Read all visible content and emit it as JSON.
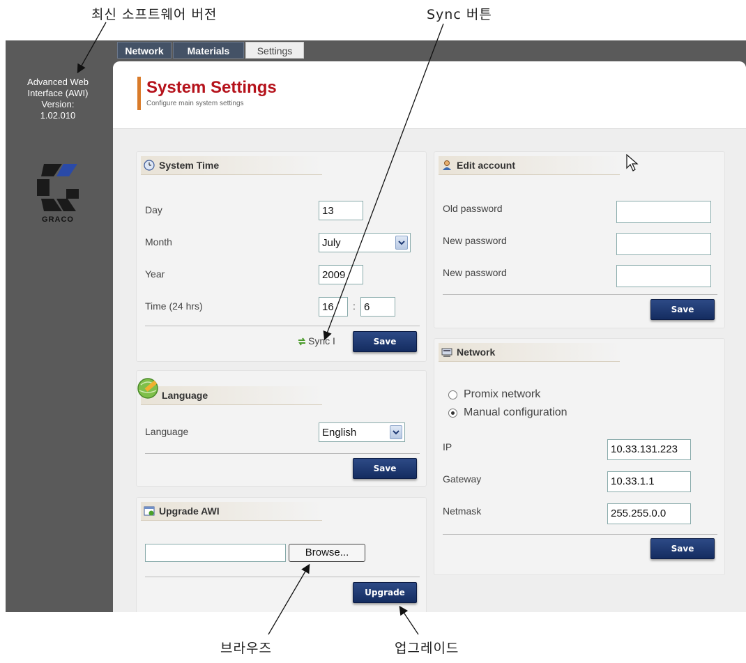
{
  "callouts": {
    "latest_version": "최신 소프트웨어 버전",
    "sync_button": "Sync 버튼",
    "browse": "브라우즈",
    "upgrade": "업그레이드"
  },
  "sidebar": {
    "version_line1": "Advanced Web",
    "version_line2": "Interface (AWI)",
    "version_line3": "Version:",
    "version_line4": "1.02.010",
    "logo_text": "GRACO"
  },
  "tabs": [
    {
      "label": "Network"
    },
    {
      "label": "Materials"
    },
    {
      "label": "Settings",
      "active": true
    }
  ],
  "header": {
    "title": "System Settings",
    "subtitle": "Configure main system settings"
  },
  "system_time": {
    "title": "System Time",
    "day_label": "Day",
    "day_value": "13",
    "month_label": "Month",
    "month_value": "July",
    "year_label": "Year",
    "year_value": "2009",
    "time_label": "Time (24 hrs)",
    "hour_value": "16",
    "minute_value": "6",
    "time_sep": ":",
    "sync_label": "Sync I",
    "save_label": "Save"
  },
  "language": {
    "title": "Language",
    "field_label": "Language",
    "value": "English",
    "save_label": "Save"
  },
  "upgrade": {
    "title": "Upgrade AWI",
    "file_value": "",
    "browse_label": "Browse...",
    "upgrade_label": "Upgrade"
  },
  "edit_account": {
    "title": "Edit account",
    "old_password_label": "Old password",
    "new_password_label": "New password",
    "confirm_password_label": "New password",
    "save_label": "Save"
  },
  "network": {
    "title": "Network",
    "option_promix": "Promix network",
    "option_manual": "Manual configuration",
    "selected": "Manual configuration",
    "ip_label": "IP",
    "ip_value": "10.33.131.223",
    "gateway_label": "Gateway",
    "gateway_value": "10.33.1.1",
    "netmask_label": "Netmask",
    "netmask_value": "255.255.0.0",
    "save_label": "Save"
  },
  "colors": {
    "rail": "#5a5a5a",
    "tab": "#445266",
    "title": "#b5121b",
    "accent": "#d97b2a",
    "button": "#1f3a74"
  }
}
